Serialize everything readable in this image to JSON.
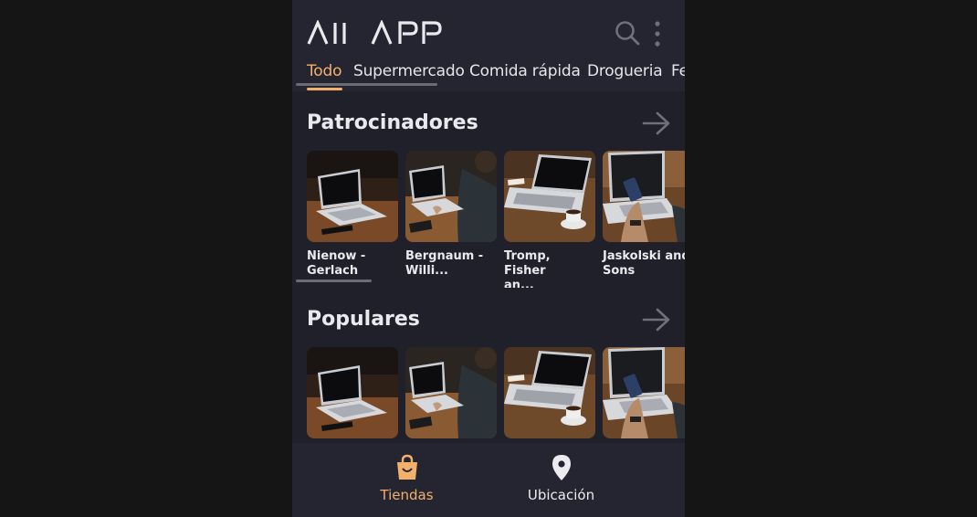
{
  "app": {
    "logo_text": "All APP"
  },
  "tabs": [
    {
      "label": "Todo",
      "active": true
    },
    {
      "label": "Supermercado",
      "active": false
    },
    {
      "label": "Comida rápida",
      "active": false
    },
    {
      "label": "Drogueria",
      "active": false
    },
    {
      "label": "Fe",
      "active": false
    }
  ],
  "sections": [
    {
      "title": "Patrocinadores",
      "items": [
        {
          "label": "Nienow -\nGerlach"
        },
        {
          "label": "Bergnaum -\nWilli..."
        },
        {
          "label": "Tromp, Fisher\nan..."
        },
        {
          "label": "Jaskolski and\nSons"
        }
      ]
    },
    {
      "title": "Populares",
      "items": [
        {
          "label": ""
        },
        {
          "label": ""
        },
        {
          "label": ""
        },
        {
          "label": ""
        }
      ]
    }
  ],
  "bottom_nav": [
    {
      "label": "Tiendas",
      "icon": "shopping-bag-icon",
      "active": true
    },
    {
      "label": "Ubicación",
      "icon": "location-pin-icon",
      "active": false
    }
  ],
  "colors": {
    "accent": "#f3b06b",
    "background": "#1f2029",
    "surface": "#242530",
    "text": "#e9e9ee",
    "muted": "#6a6b73"
  }
}
